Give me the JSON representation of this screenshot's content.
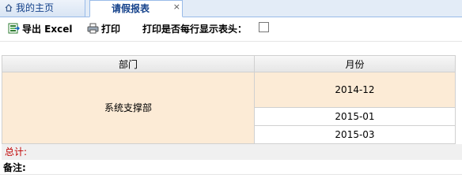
{
  "tabs": {
    "home_label": "我的主页",
    "report_label": "请假报表",
    "close_glyph": "×"
  },
  "toolbar": {
    "export_label": "导出 Excel",
    "print_label": "打印",
    "print_header_label": "打印是否每行显示表头：",
    "print_header_checked": false
  },
  "table": {
    "columns": [
      "部门",
      "月份"
    ],
    "department": "系统支撑部",
    "months": [
      "2014-12",
      "2015-01",
      "2015-03"
    ]
  },
  "footer": {
    "total_label": "总计:",
    "remark_label": "备注:"
  },
  "colors": {
    "highlight_row": "#fcebd6",
    "total_text": "#c00000",
    "tab_text": "#15428b"
  },
  "icons": [
    "home-icon",
    "excel-icon",
    "printer-icon",
    "close-icon"
  ]
}
